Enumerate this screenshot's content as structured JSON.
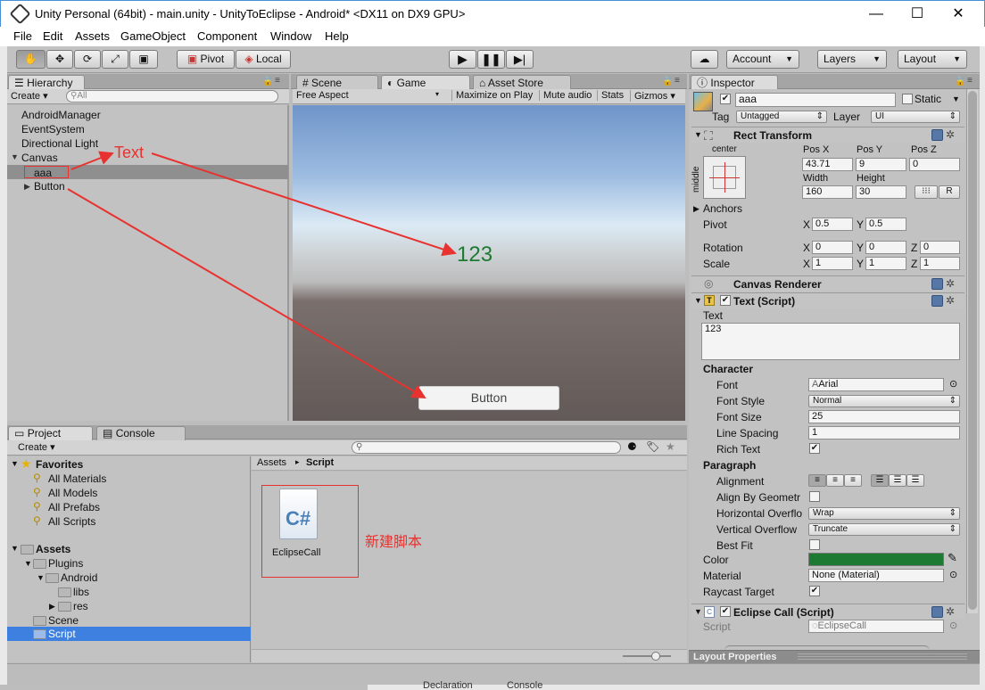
{
  "window": {
    "title": "Unity Personal (64bit) - main.unity - UnityToEclipse - Android* <DX11 on DX9 GPU>",
    "minimize_icon": "minimize-icon",
    "maximize_icon": "maximize-icon",
    "close_icon": "close-icon"
  },
  "menu": [
    "File",
    "Edit",
    "Assets",
    "GameObject",
    "Component",
    "Window",
    "Help"
  ],
  "toolbar": {
    "pivot": "Pivot",
    "local": "Local",
    "account": "Account",
    "layers": "Layers",
    "layout": "Layout"
  },
  "hierarchy": {
    "tab": "Hierarchy",
    "create": "Create",
    "search_placeholder": "All",
    "items": [
      "AndroidManager",
      "EventSystem",
      "Directional Light",
      "Canvas",
      "aaa",
      "Button"
    ]
  },
  "scene_tabs": {
    "scene": "Scene",
    "game": "Game",
    "asset_store": "Asset Store"
  },
  "game_toolbar": {
    "aspect": "Free Aspect",
    "maximize": "Maximize on Play",
    "mute": "Mute audio",
    "stats": "Stats",
    "gizmos": "Gizmos"
  },
  "game_view": {
    "text_value": "123",
    "button_label": "Button"
  },
  "annotations": {
    "text_label": "Text",
    "new_script": "新建脚本",
    "arrow_color": "#e8322f"
  },
  "project": {
    "tab": "Project",
    "console_tab": "Console",
    "create": "Create",
    "favorites": "Favorites",
    "fav_items": [
      "All Materials",
      "All Models",
      "All Prefabs",
      "All Scripts"
    ],
    "assets": "Assets",
    "tree": [
      "Plugins",
      "Android",
      "libs",
      "res",
      "Scene",
      "Script"
    ],
    "breadcrumb": [
      "Assets",
      "Script"
    ],
    "file_name": "EclipseCall",
    "file_icon": "C#"
  },
  "inspector": {
    "tab": "Inspector",
    "name": "aaa",
    "static": "Static",
    "tag_label": "Tag",
    "tag": "Untagged",
    "layer_label": "Layer",
    "layer": "UI",
    "rect_transform": "Rect Transform",
    "anchor_h": "center",
    "anchor_v": "middle",
    "posx_label": "Pos X",
    "posy_label": "Pos Y",
    "posz_label": "Pos Z",
    "posx": "43.71",
    "posy": "9",
    "posz": "0",
    "width_label": "Width",
    "height_label": "Height",
    "width": "160",
    "height": "30",
    "r_button": "R",
    "anchors": "Anchors",
    "pivot_label": "Pivot",
    "pivot_x": "0.5",
    "pivot_y": "0.5",
    "rotation_label": "Rotation",
    "rot_x": "0",
    "rot_y": "0",
    "rot_z": "0",
    "scale_label": "Scale",
    "scale_x": "1",
    "scale_y": "1",
    "scale_z": "1",
    "x": "X",
    "y": "Y",
    "z": "Z",
    "canvas_renderer": "Canvas Renderer",
    "text_script": "Text (Script)",
    "text_label": "Text",
    "text_value": "123",
    "character": "Character",
    "font_label": "Font",
    "font": "Arial",
    "font_style_label": "Font Style",
    "font_style": "Normal",
    "font_size_label": "Font Size",
    "font_size": "25",
    "line_spacing_label": "Line Spacing",
    "line_spacing": "1",
    "rich_text_label": "Rich Text",
    "paragraph": "Paragraph",
    "alignment_label": "Alignment",
    "align_geometry_label": "Align By Geometr",
    "h_overflow_label": "Horizontal Overflo",
    "h_overflow": "Wrap",
    "v_overflow_label": "Vertical Overflow",
    "v_overflow": "Truncate",
    "best_fit_label": "Best Fit",
    "color_label": "Color",
    "color": "#1d7a32",
    "material_label": "Material",
    "material": "None (Material)",
    "raycast_label": "Raycast Target",
    "eclipse_call": "Eclipse Call (Script)",
    "script_label": "Script",
    "script_value": "EclipseCall",
    "layout_properties": "Layout Properties"
  },
  "taskbar": {
    "declaration": "Declaration",
    "console": "Console"
  }
}
